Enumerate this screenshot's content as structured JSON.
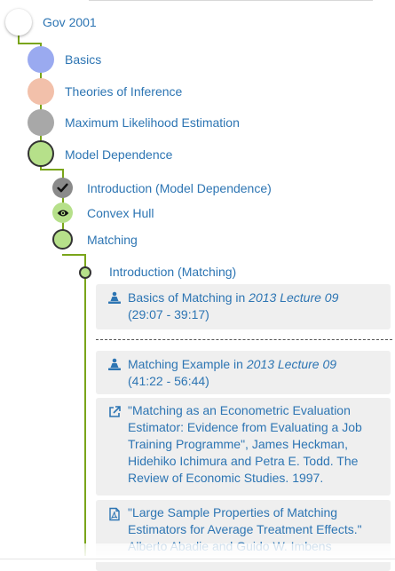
{
  "tree": {
    "root": {
      "label": "Gov 2001"
    },
    "level1": [
      {
        "label": "Basics",
        "color": "#9aaaf0"
      },
      {
        "label": "Theories of Inference",
        "color": "#f2c0aa"
      },
      {
        "label": "Maximum Likelihood Estimation",
        "color": "#a8a8a8"
      },
      {
        "label": "Model Dependence",
        "color": "#b6e08a"
      }
    ],
    "level2": [
      {
        "label": "Introduction (Model Dependence)",
        "icon": "check-icon"
      },
      {
        "label": "Convex Hull",
        "icon": "eye-icon"
      },
      {
        "label": "Matching",
        "icon": "none"
      }
    ],
    "level3": [
      {
        "label": "Introduction (Matching)"
      }
    ]
  },
  "resources": [
    {
      "icon": "lecture-icon",
      "prefix": "Basics of Matching in ",
      "source": "2013 Lecture 09",
      "time": "(29:07 - 39:17)"
    },
    {
      "icon": "lecture-icon",
      "prefix": "Matching Example in ",
      "source": "2013 Lecture 09",
      "time": "(41:22 - 56:44)"
    },
    {
      "icon": "external-link-icon",
      "l1": "\"Matching as an Econometric Evaluation",
      "l2": "Estimator: Evidence from Evaluating a Job",
      "l3": "Training Programme\", James Heckman,",
      "l4": "Hidehiko Ichimura and Petra E. Todd. The",
      "l5": "Review of Economic Studies. 1997."
    },
    {
      "icon": "pdf-icon",
      "l1": "\"Large Sample Properties of Matching",
      "l2": "Estimators for Average Treatment Effects.\"",
      "l3": "Alberto Abadie and Guido W. Imbens"
    }
  ],
  "colors": {
    "link": "#2d75b3",
    "connector": "#7aa51a",
    "card_bg": "#efefef"
  }
}
